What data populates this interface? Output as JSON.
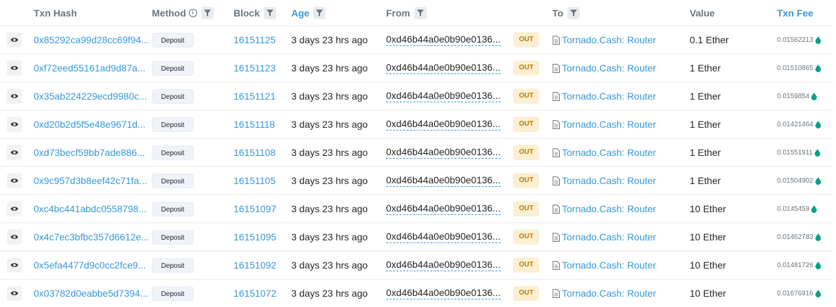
{
  "header": {
    "txn_hash": "Txn Hash",
    "method": "Method",
    "block": "Block",
    "age": "Age",
    "from": "From",
    "to": "To",
    "value": "Value",
    "txn_fee": "Txn Fee"
  },
  "colors": {
    "link": "#3498db",
    "out_badge_bg": "#fcefd2",
    "out_badge_text": "#b47d00",
    "gas_icon": "#00a186"
  },
  "icons": {
    "view": "eye-icon",
    "filter": "filter-icon",
    "info": "info-icon",
    "contract": "contract-document-icon",
    "gas": "gas-drop-icon"
  },
  "rows": [
    {
      "hash": "0x85292ca99d28cc69f94...",
      "method": "Deposit",
      "block": "16151125",
      "age": "3 days 23 hrs ago",
      "from": "0xd46b44a0e0b90e0136...",
      "direction": "OUT",
      "to": "Tornado.Cash: Router",
      "value": "0.1 Ether",
      "fee": "0.01562213"
    },
    {
      "hash": "0xf72eed55161ad9d87a...",
      "method": "Deposit",
      "block": "16151123",
      "age": "3 days 23 hrs ago",
      "from": "0xd46b44a0e0b90e0136...",
      "direction": "OUT",
      "to": "Tornado.Cash: Router",
      "value": "1 Ether",
      "fee": "0.01510865"
    },
    {
      "hash": "0x35ab224229ecd9980c...",
      "method": "Deposit",
      "block": "16151121",
      "age": "3 days 23 hrs ago",
      "from": "0xd46b44a0e0b90e0136...",
      "direction": "OUT",
      "to": "Tornado.Cash: Router",
      "value": "1 Ether",
      "fee": "0.0159854"
    },
    {
      "hash": "0xd20b2d5f5e48e9671d...",
      "method": "Deposit",
      "block": "16151118",
      "age": "3 days 23 hrs ago",
      "from": "0xd46b44a0e0b90e0136...",
      "direction": "OUT",
      "to": "Tornado.Cash: Router",
      "value": "1 Ether",
      "fee": "0.01421464"
    },
    {
      "hash": "0xd73becf59bb7ade886...",
      "method": "Deposit",
      "block": "16151108",
      "age": "3 days 23 hrs ago",
      "from": "0xd46b44a0e0b90e0136...",
      "direction": "OUT",
      "to": "Tornado.Cash: Router",
      "value": "1 Ether",
      "fee": "0.01551911"
    },
    {
      "hash": "0x9c957d3b8eef42c71fa...",
      "method": "Deposit",
      "block": "16151105",
      "age": "3 days 23 hrs ago",
      "from": "0xd46b44a0e0b90e0136...",
      "direction": "OUT",
      "to": "Tornado.Cash: Router",
      "value": "1 Ether",
      "fee": "0.01504902"
    },
    {
      "hash": "0xc4bc441abdc0558798...",
      "method": "Deposit",
      "block": "16151097",
      "age": "3 days 23 hrs ago",
      "from": "0xd46b44a0e0b90e0136...",
      "direction": "OUT",
      "to": "Tornado.Cash: Router",
      "value": "10 Ether",
      "fee": "0.0145459"
    },
    {
      "hash": "0x4c7ec3bfbc357d6612e...",
      "method": "Deposit",
      "block": "16151095",
      "age": "3 days 23 hrs ago",
      "from": "0xd46b44a0e0b90e0136...",
      "direction": "OUT",
      "to": "Tornado.Cash: Router",
      "value": "10 Ether",
      "fee": "0.01462783"
    },
    {
      "hash": "0x5efa4477d9c0cc2fce9...",
      "method": "Deposit",
      "block": "16151092",
      "age": "3 days 23 hrs ago",
      "from": "0xd46b44a0e0b90e0136...",
      "direction": "OUT",
      "to": "Tornado.Cash: Router",
      "value": "10 Ether",
      "fee": "0.01481726"
    },
    {
      "hash": "0x03782d0eabbe5d7394...",
      "method": "Deposit",
      "block": "16151072",
      "age": "3 days 23 hrs ago",
      "from": "0xd46b44a0e0b90e0136...",
      "direction": "OUT",
      "to": "Tornado.Cash: Router",
      "value": "10 Ether",
      "fee": "0.01676916"
    }
  ]
}
